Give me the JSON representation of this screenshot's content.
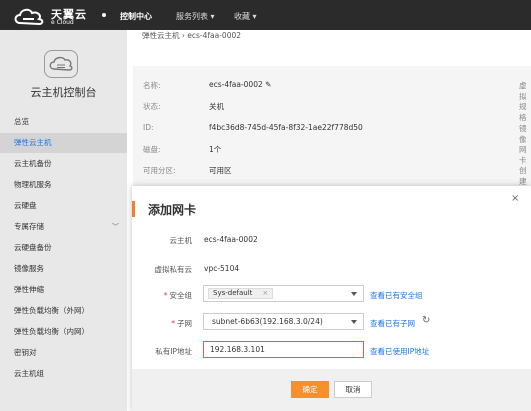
{
  "topbar": {
    "logo_cn": "天翼云",
    "logo_en": "e Cloud",
    "nav": [
      "控制中心",
      "服务列表 ▾",
      "收藏 ▾"
    ]
  },
  "sidebar": {
    "title": "云主机控制台",
    "items": [
      {
        "label": "总览"
      },
      {
        "label": "弹性云主机",
        "active": true
      },
      {
        "label": "云主机备份"
      },
      {
        "label": "物理机服务"
      },
      {
        "label": "云硬盘"
      },
      {
        "label": "专属存储",
        "expandable": true
      },
      {
        "label": "云硬盘备份"
      },
      {
        "label": "镜像服务"
      },
      {
        "label": "弹性伸缩"
      },
      {
        "label": "弹性负载均衡（外网）"
      },
      {
        "label": "弹性负载均衡（内网）"
      },
      {
        "label": "密钥对"
      },
      {
        "label": "云主机组"
      }
    ]
  },
  "breadcrumb": "弹性云主机 › ecs-4faa-0002",
  "details": [
    {
      "label": "名称:",
      "value": "ecs-4faa-0002 ✎",
      "right": "虚拟"
    },
    {
      "label": "状态:",
      "value": "关机",
      "right": "规格"
    },
    {
      "label": "ID:",
      "value": "f4bc36d8-745d-45fa-8f32-1ae22f778d50",
      "right": "镜像"
    },
    {
      "label": "磁盘:",
      "value": "1个",
      "right": "网卡"
    },
    {
      "label": "可用分区:",
      "value": "可用区",
      "right": "创建"
    }
  ],
  "modal": {
    "title": "添加网卡",
    "close": "×",
    "host_label": "云主机",
    "host_value": "ecs-4faa-0002",
    "vpc_label": "虚拟私有云",
    "vpc_value": "vpc-5104",
    "sg_label": "安全组",
    "sg_tag": "Sys-default",
    "sg_tag_close": "×",
    "sg_link": "查看已有安全组",
    "subnet_label": "子网",
    "subnet_value": "subnet-6b63(192.168.3.0/24)",
    "subnet_link": "查看已有子网",
    "ip_label": "私有IP地址",
    "ip_value": "192.168.3.101",
    "ip_link": "查看已使用IP地址",
    "required_mark": "*",
    "ok": "确定",
    "cancel": "取消"
  },
  "colors": {
    "accent": "#f7902b",
    "link": "#1a73e8",
    "topbar": "#2b2b2b",
    "error_border": "#e55"
  }
}
